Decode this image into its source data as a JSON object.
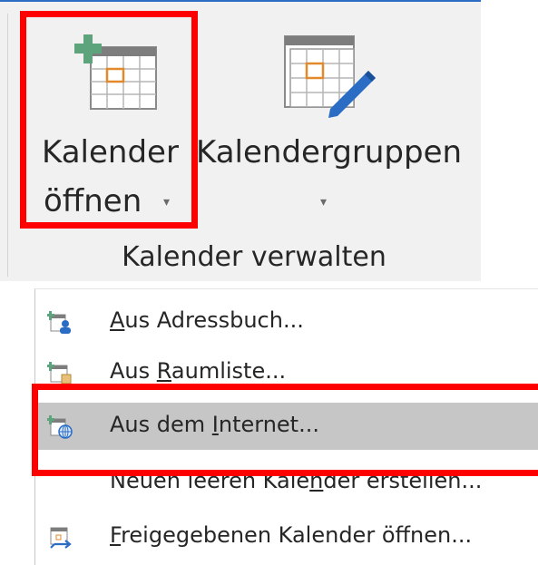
{
  "ribbon": {
    "open_calendar": {
      "line1": "Kalender",
      "line2": "öffnen",
      "caret": "▾",
      "icon": "calendar-plus-icon"
    },
    "calendar_groups": {
      "line1": "Kalendergruppen",
      "caret": "▾",
      "icon": "calendar-pencil-icon"
    },
    "group_title": "Kalender verwalten"
  },
  "menu": {
    "items": [
      {
        "pre": "",
        "ul": "A",
        "post": "us Adressbuch...",
        "icon": "address-book-calendar-icon"
      },
      {
        "pre": "Aus ",
        "ul": "R",
        "post": "aumliste...",
        "icon": "room-list-calendar-icon"
      },
      {
        "pre": "Aus dem ",
        "ul": "I",
        "post": "nternet...",
        "icon": "internet-calendar-icon"
      },
      {
        "pre": "Neuen leeren Kale",
        "ul": "n",
        "post": "der erstellen...",
        "icon": ""
      },
      {
        "pre": "",
        "ul": "F",
        "post": "reigegebenen Kalender öffnen...",
        "icon": "shared-calendar-icon"
      }
    ]
  },
  "colors": {
    "highlight": "#ff0000",
    "hover": "#c6c6c6",
    "accent_green": "#5da37b",
    "accent_orange": "#e28a2b",
    "accent_blue": "#2b6cc4"
  }
}
